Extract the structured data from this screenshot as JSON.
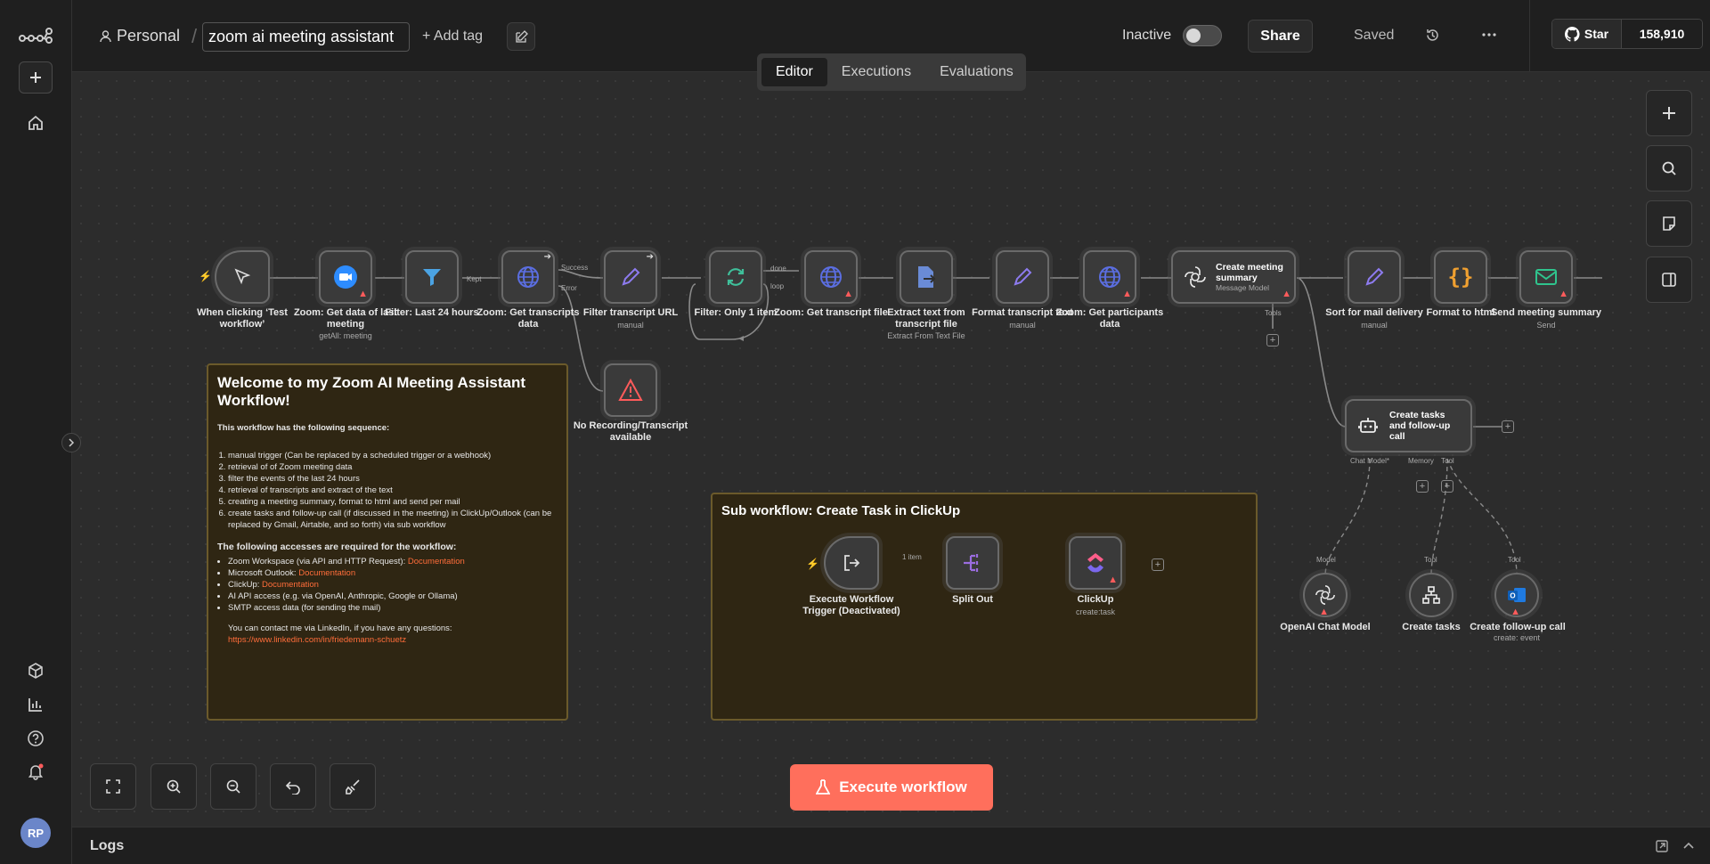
{
  "header": {
    "project": "Personal",
    "workflow_name": "zoom ai meeting assistant",
    "add_tag": "+ Add tag",
    "status": "Inactive",
    "share": "Share",
    "saved": "Saved",
    "github_star": "Star",
    "github_count": "158,910"
  },
  "tabs": [
    "Editor",
    "Executions",
    "Evaluations"
  ],
  "nodes": {
    "n1": {
      "label": "When clicking ‘Test workflow’",
      "sub": ""
    },
    "n2": {
      "label": "Zoom: Get data of last meeting",
      "sub": "getAll: meeting"
    },
    "n3": {
      "label": "Filter: Last 24 hours",
      "sub": ""
    },
    "n4": {
      "label": "Zoom: Get transcripts data",
      "sub": ""
    },
    "n5": {
      "label": "Filter transcript URL",
      "sub": "manual"
    },
    "n6": {
      "label": "Filter: Only 1 item",
      "sub": ""
    },
    "n7": {
      "label": "Zoom: Get transcript file",
      "sub": ""
    },
    "n8": {
      "label": "Extract text from transcript file",
      "sub": "Extract From Text File"
    },
    "n9": {
      "label": "Format transcript text",
      "sub": "manual"
    },
    "n10": {
      "label": "Zoom: Get participants data",
      "sub": ""
    },
    "n11": {
      "label": "Create meeting summary",
      "sub": "Message Model"
    },
    "n12": {
      "label": "Sort for mail delivery",
      "sub": "manual"
    },
    "n13": {
      "label": "Format to html",
      "sub": ""
    },
    "n14": {
      "label": "Send meeting summary",
      "sub": "Send"
    },
    "n15": {
      "label": "No Recording/Transcript available",
      "sub": ""
    },
    "n16": {
      "label": "Create tasks and follow-up call",
      "sub": ""
    },
    "n17": {
      "label": "OpenAI Chat Model",
      "sub": ""
    },
    "n18": {
      "label": "Create tasks",
      "sub": ""
    },
    "n19": {
      "label": "Create follow-up call",
      "sub": "create: event"
    },
    "n20": {
      "label": "Execute Workflow Trigger (Deactivated)",
      "sub": ""
    },
    "n21": {
      "label": "Split Out",
      "sub": ""
    },
    "n22": {
      "label": "ClickUp",
      "sub": "create:task"
    }
  },
  "edge_labels": {
    "kept": "Kept",
    "success": "Success",
    "error": "Error",
    "done": "done",
    "loop": "loop",
    "tools": "Tools",
    "chat_model": "Chat Model*",
    "memory": "Memory",
    "tool": "Tool",
    "model": "Model",
    "one_item": "1 item"
  },
  "sticky_welcome": {
    "title": "Welcome to my Zoom AI Meeting Assistant Workflow!",
    "intro": "This workflow has the following sequence:",
    "steps": [
      "manual trigger (Can be replaced by a scheduled trigger or a webhook)",
      "retrieval of of Zoom meeting data",
      "filter the events of the last 24 hours",
      "retrieval of transcripts and extract of the text",
      "creating a meeting summary, format to html and send per mail",
      "create tasks and follow-up call (if discussed in the meeting) in ClickUp/Outlook (can be replaced by Gmail, Airtable, and so forth) via sub workflow"
    ],
    "access_title": "The following accesses are required for the workflow:",
    "access": [
      {
        "text": "Zoom Workspace (via API and HTTP Request): ",
        "link": "Documentation"
      },
      {
        "text": "Microsoft Outlook: ",
        "link": "Documentation"
      },
      {
        "text": "ClickUp: ",
        "link": "Documentation"
      },
      {
        "text": "AI API access (e.g. via OpenAI, Anthropic, Google or Ollama)",
        "link": ""
      },
      {
        "text": "SMTP access data (for sending the mail)",
        "link": ""
      }
    ],
    "contact": "You can contact me via LinkedIn, if you have any questions:",
    "contact_link": "https://www.linkedin.com/in/friedemann-schuetz"
  },
  "sticky_sub": {
    "title": "Sub workflow: Create Task in ClickUp"
  },
  "execute_button": "Execute workflow",
  "logs": "Logs",
  "colors": {
    "accent": "#ff6f5c",
    "zoom": "#2d8cff",
    "http": "#5b6ee1",
    "warn": "#ff5b5b"
  }
}
